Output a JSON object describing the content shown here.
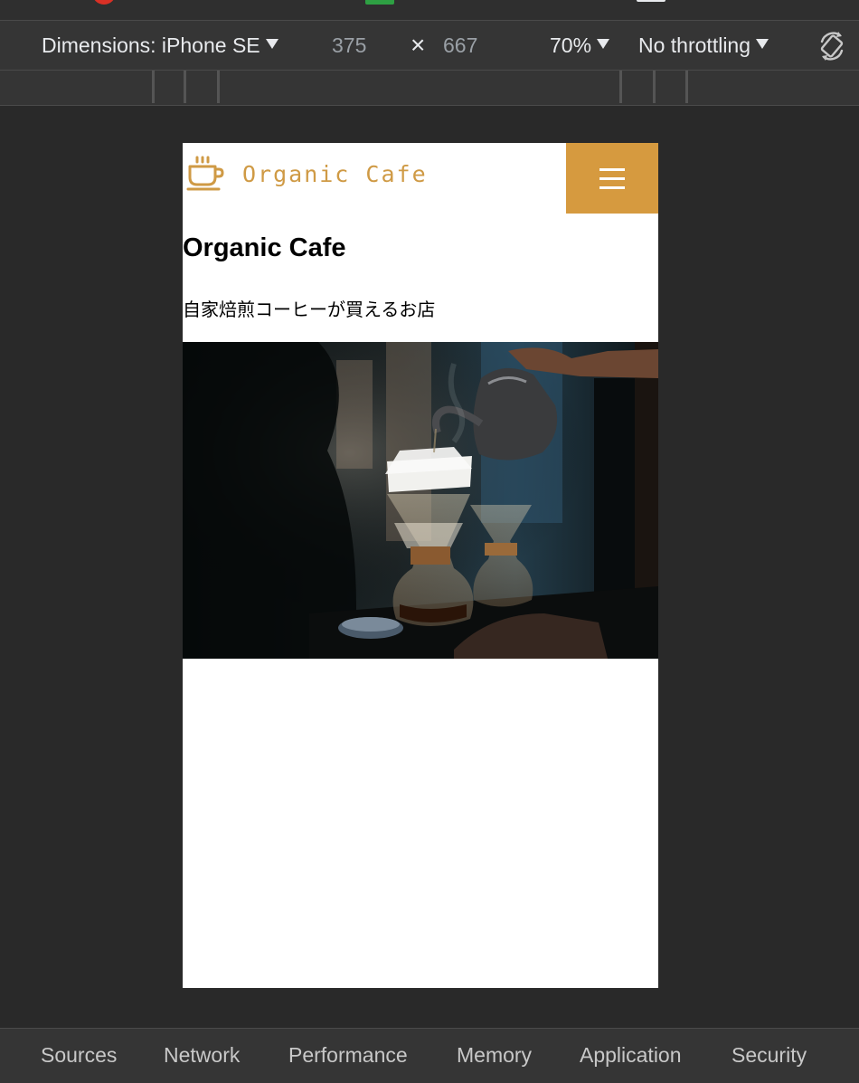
{
  "toolbar": {
    "device_label": "Dimensions: iPhone SE",
    "width": "375",
    "times": "×",
    "height": "667",
    "zoom": "70%",
    "throttling": "No throttling",
    "rotate_icon": "rotate-icon"
  },
  "site": {
    "logo_icon": "coffee-cup-icon",
    "logo_text": "Organic Cafe",
    "menu_icon": "hamburger-menu-icon",
    "title": "Organic Cafe",
    "subtitle": "自家焙煎コーヒーが買えるお店",
    "accent_color": "#d69a3f",
    "logo_color": "#cf9a45"
  },
  "bottom_tabs": [
    "Sources",
    "Network",
    "Performance",
    "Memory",
    "Application",
    "Security"
  ]
}
